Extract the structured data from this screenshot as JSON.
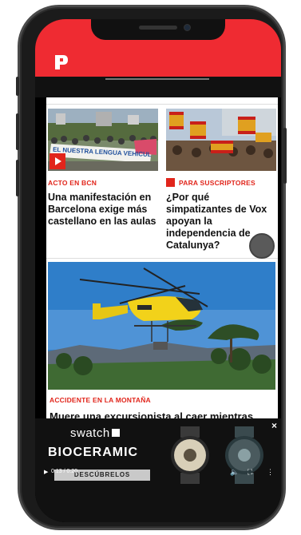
{
  "articles": [
    {
      "tag": "ACTO EN BCN",
      "headline": "Una manifestación en Barcelona exige más castellano en las aulas",
      "banner_text": "EL NUESTRA LENGUA VEHICULAR"
    },
    {
      "tag": "PARA SUSCRIPTORES",
      "headline": "¿Por qué simpatizantes de Vox apoyan la independencia de Catalunya?"
    },
    {
      "tag": "ACCIDENTE EN LA MONTAÑA",
      "headline": "Muere una excursionista al caer mientras"
    }
  ],
  "ad": {
    "brand": "swatch",
    "title": "BIOCERAMIC",
    "cta": "DESCÚBRELOS",
    "time": "0:13 / 0:20",
    "close": "×"
  },
  "colors": {
    "brand_red": "#ef2b32",
    "tag_red": "#e1251b"
  }
}
